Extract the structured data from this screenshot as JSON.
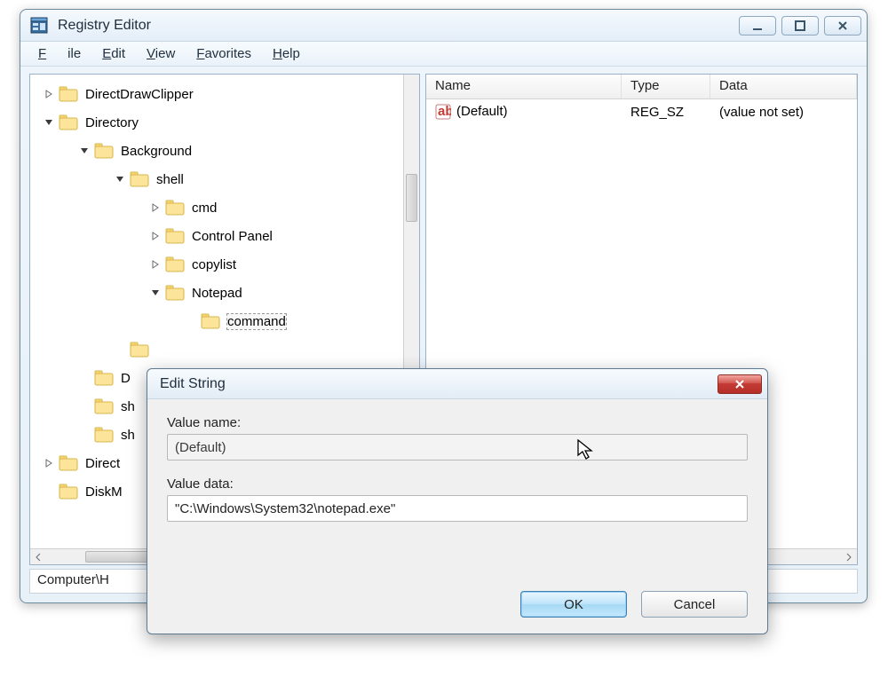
{
  "window": {
    "title": "Registry Editor"
  },
  "menu": {
    "file": "File",
    "edit": "Edit",
    "view": "View",
    "favorites": "Favorites",
    "help": "Help"
  },
  "tree": {
    "n0": "DirectDrawClipper",
    "n1": "Directory",
    "n2": "Background",
    "n3": "shell",
    "n4": "cmd",
    "n5": "Control Panel",
    "n6": "copylist",
    "n7": "Notepad",
    "n8": "command",
    "n9": "D",
    "n10": "sh",
    "n11": "sh",
    "n12": "Direct",
    "n13": "DiskM"
  },
  "list": {
    "col_name": "Name",
    "col_type": "Type",
    "col_data": "Data",
    "row0": {
      "name": "(Default)",
      "type": "REG_SZ",
      "data": "(value not set)"
    }
  },
  "status": {
    "path": "Computer\\H"
  },
  "dialog": {
    "title": "Edit String",
    "value_name_label": "Value name:",
    "value_name": "(Default)",
    "value_data_label": "Value data:",
    "value_data": "\"C:\\Windows\\System32\\notepad.exe\"",
    "ok": "OK",
    "cancel": "Cancel"
  }
}
